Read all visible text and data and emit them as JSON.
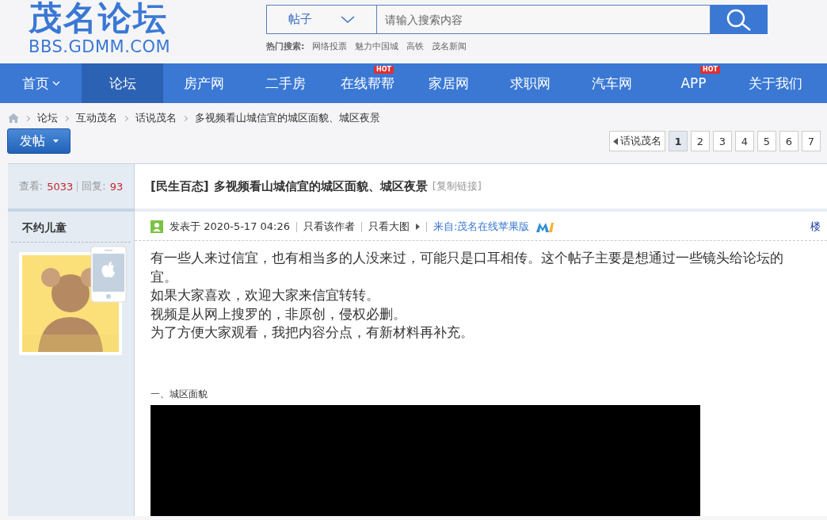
{
  "logo": {
    "title": "茂名论坛",
    "domain": "BBS.GDMM.COM"
  },
  "search": {
    "type_label": "帖子",
    "placeholder": "请输入搜索内容",
    "hot_label": "热门搜索:",
    "hot_terms": [
      "网络投票",
      "魅力中国城",
      "高铁",
      "茂名新闻"
    ]
  },
  "nav": [
    {
      "label": "首页",
      "selected": false,
      "dropdown": true
    },
    {
      "label": "论坛",
      "selected": true
    },
    {
      "label": "房产网",
      "selected": false
    },
    {
      "label": "二手房",
      "selected": false
    },
    {
      "label": "在线帮帮",
      "selected": false,
      "badge": "HOT"
    },
    {
      "label": "家居网",
      "selected": false
    },
    {
      "label": "求职网",
      "selected": false
    },
    {
      "label": "汽车网",
      "selected": false
    },
    {
      "label": "APP",
      "selected": false,
      "badge": "HOT"
    },
    {
      "label": "关于我们",
      "selected": false
    }
  ],
  "breadcrumb": [
    "论坛",
    "互动茂名",
    "话说茂名",
    "多视频看山城信宜的城区面貌、城区夜景"
  ],
  "post_button": "发帖",
  "pagination": {
    "back": "话说茂名",
    "pages": [
      {
        "label": "1",
        "selected": true
      },
      {
        "label": "2",
        "selected": false
      },
      {
        "label": "3",
        "selected": false
      },
      {
        "label": "4",
        "selected": false
      },
      {
        "label": "5",
        "selected": false
      },
      {
        "label": "6",
        "selected": false
      },
      {
        "label": "7",
        "selected": false
      }
    ]
  },
  "stats": {
    "views_label": "查看:",
    "views": "5033",
    "replies_label": "回复:",
    "replies": "93"
  },
  "thread": {
    "category": "[民生百态]",
    "title": "多视频看山城信宜的城区面貌、城区夜景",
    "copy_link": "[复制链接]"
  },
  "author": {
    "name": "不约儿童"
  },
  "post_meta": {
    "posted": "发表于 2020-5-17 04:26",
    "only_author": "只看该作者",
    "big_image": "只看大图",
    "source": "来自:茂名在线苹果版",
    "floor": "楼"
  },
  "body": [
    "有一些人来过信宜，也有相当多的人没来过，可能只是口耳相传。这个帖子主要是想通过一些镜头给论坛的",
    "宜。",
    "如果大家喜欢，欢迎大家来信宜转转。",
    "视频是从网上搜罗的，非原创，侵权必删。",
    "为了方便大家观看，我把内容分点，有新材料再补充。"
  ],
  "section_heading": "一、城区面貌"
}
